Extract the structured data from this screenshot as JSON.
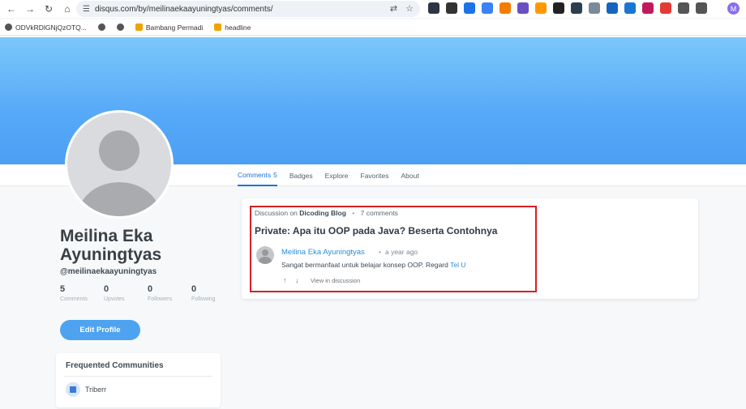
{
  "browser": {
    "url": "disqus.com/by/meilinaekaayuningtyas/comments/",
    "profile_initial": "M",
    "bookmarks": [
      {
        "label": "ODVkRDlGNjQzOTQ..."
      },
      {
        "label": ""
      },
      {
        "label": "Bambang Permadi"
      },
      {
        "label": "headline"
      }
    ],
    "extensions": [
      {
        "name": "shield-icon",
        "color": "#2d3446"
      },
      {
        "name": "circle-icon",
        "color": "#333333"
      },
      {
        "name": "blue-square-icon",
        "color": "#1a73e8"
      },
      {
        "name": "copy-icon",
        "color": "#3b82f6"
      },
      {
        "name": "rss-icon",
        "color": "#f57c00"
      },
      {
        "name": "cloud-icon",
        "color": "#6a4fc2"
      },
      {
        "name": "notebook-icon",
        "color": "#ff9800"
      },
      {
        "name": "dark-icon",
        "color": "#222222"
      },
      {
        "name": "picture-icon",
        "color": "#2c3e50"
      },
      {
        "name": "bird-icon",
        "color": "#7a8a99"
      },
      {
        "name": "c-icon",
        "color": "#1565c0"
      },
      {
        "name": "b-icon",
        "color": "#1976d2"
      },
      {
        "name": "monitor-icon",
        "color": "#c2185b"
      },
      {
        "name": "red-arrow-icon",
        "color": "#e53935"
      },
      {
        "name": "puzzle-icon",
        "color": "#555555"
      },
      {
        "name": "sidebar-icon",
        "color": "#555555"
      }
    ]
  },
  "tabs": [
    {
      "label": "Comments",
      "count": "5",
      "active": true
    },
    {
      "label": "Badges"
    },
    {
      "label": "Explore"
    },
    {
      "label": "Favorites"
    },
    {
      "label": "About"
    }
  ],
  "profile": {
    "name_line1": "Meilina Eka",
    "name_line2": "Ayuningtyas",
    "handle": "@meilinaekaayuningtyas",
    "stats": [
      {
        "value": "5",
        "label": "Comments"
      },
      {
        "value": "0",
        "label": "Upvotes"
      },
      {
        "value": "0",
        "label": "Followers"
      },
      {
        "value": "0",
        "label": "Following"
      }
    ],
    "edit_button": "Edit Profile"
  },
  "communities": {
    "title": "Frequented Communities",
    "items": [
      {
        "name": "Triberr"
      }
    ]
  },
  "comment": {
    "discussion_prefix": "Discussion on",
    "forum": "Dicoding Blog",
    "comment_count": "7 comments",
    "title": "Private: Apa itu OOP pada Java? Beserta Contohnya",
    "author": "Meilina Eka Ayuningtyas",
    "time": "a year ago",
    "text": "Sangat bermanfaat untuk belajar konsep OOP. Regard",
    "text_tail": "Tel U",
    "upvote": "↑",
    "downvote": "↓",
    "view_link": "View in discussion"
  },
  "colors": {
    "accent": "#1d72d8",
    "banner": "#56a9f8",
    "edit_button": "#4da3f0",
    "highlight": "#d62026",
    "link": "#2a8fd1"
  }
}
